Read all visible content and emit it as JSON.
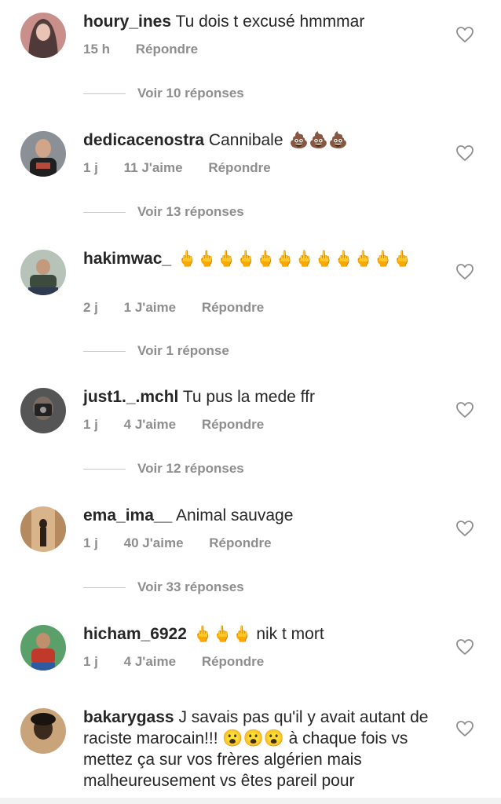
{
  "comments": [
    {
      "user": "houry_ines",
      "text": "Tu dois t excusé hmmmar",
      "emoji": "",
      "time": "15 h",
      "likes": "",
      "reply": "Répondre",
      "replies": "Voir 10 réponses",
      "avatar_colors": [
        "#c98f8a",
        "#3a2a2a"
      ]
    },
    {
      "user": "dedicacenostra",
      "text": "Cannibale",
      "emoji": "💩💩💩",
      "time": "1 j",
      "likes": "11 J'aime",
      "reply": "Répondre",
      "replies": "Voir 13 réponses",
      "avatar_colors": [
        "#8b8f96",
        "#b44a3a"
      ]
    },
    {
      "user": "hakimwac_",
      "text": "",
      "emoji": "🖕🖕🖕🖕🖕🖕🖕🖕🖕🖕🖕🖕",
      "time": "2 j",
      "likes": "1 J'aime",
      "reply": "Répondre",
      "replies": "Voir 1 réponse",
      "avatar_colors": [
        "#b7c3b8",
        "#3d4b3f"
      ]
    },
    {
      "user": "just1._.mchl",
      "text": "Tu pus la mede ffr",
      "emoji": "",
      "time": "1 j",
      "likes": "4 J'aime",
      "reply": "Répondre",
      "replies": "Voir 12 réponses",
      "avatar_colors": [
        "#555",
        "#222"
      ]
    },
    {
      "user": "ema_ima__",
      "text": "Animal sauvage",
      "emoji": "",
      "time": "1 j",
      "likes": "40 J'aime",
      "reply": "Répondre",
      "replies": "Voir 33 réponses",
      "avatar_colors": [
        "#d9b48a",
        "#2b1f18"
      ]
    },
    {
      "user": "hicham_6922",
      "text": "nik t mort",
      "emoji": "🖕🖕🖕",
      "time": "1 j",
      "likes": "4 J'aime",
      "reply": "Répondre",
      "replies": "",
      "avatar_colors": [
        "#5aa06a",
        "#c0392b"
      ]
    },
    {
      "user": "bakarygass",
      "text": "J savais pas qu'il y avait autant de raciste marocain!!! 😮😮😮 à chaque fois vs mettez ça sur vos frères algérien mais malheureusement vs êtes pareil pour",
      "emoji": "",
      "time": "",
      "likes": "",
      "reply": "",
      "replies": "",
      "avatar_colors": [
        "#c9a47a",
        "#3b2a1e"
      ]
    }
  ]
}
